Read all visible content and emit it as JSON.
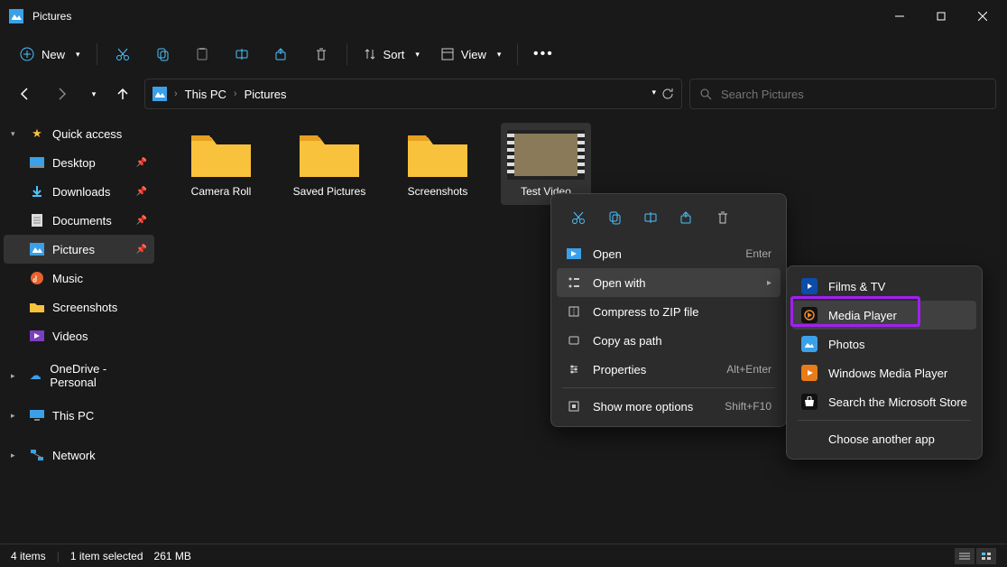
{
  "window": {
    "title": "Pictures"
  },
  "toolbar": {
    "new": "New",
    "sort": "Sort",
    "view": "View"
  },
  "breadcrumb": {
    "part1": "This PC",
    "part2": "Pictures"
  },
  "search": {
    "placeholder": "Search Pictures"
  },
  "sidebar": {
    "quick_access": "Quick access",
    "desktop": "Desktop",
    "downloads": "Downloads",
    "documents": "Documents",
    "pictures": "Pictures",
    "music": "Music",
    "screenshots": "Screenshots",
    "videos": "Videos",
    "onedrive": "OneDrive - Personal",
    "this_pc": "This PC",
    "network": "Network"
  },
  "items": [
    {
      "label": "Camera Roll"
    },
    {
      "label": "Saved Pictures"
    },
    {
      "label": "Screenshots"
    },
    {
      "label": "Test Video"
    }
  ],
  "ctx1": {
    "open": "Open",
    "open_sc": "Enter",
    "open_with": "Open with",
    "zip": "Compress to ZIP file",
    "copy_path": "Copy as path",
    "properties": "Properties",
    "properties_sc": "Alt+Enter",
    "more": "Show more options",
    "more_sc": "Shift+F10"
  },
  "ctx2": {
    "films_tv": "Films & TV",
    "media_player": "Media Player",
    "photos": "Photos",
    "wmp": "Windows Media Player",
    "store": "Search the Microsoft Store",
    "choose": "Choose another app"
  },
  "status": {
    "count": "4 items",
    "selected": "1 item selected",
    "size": "261 MB"
  }
}
